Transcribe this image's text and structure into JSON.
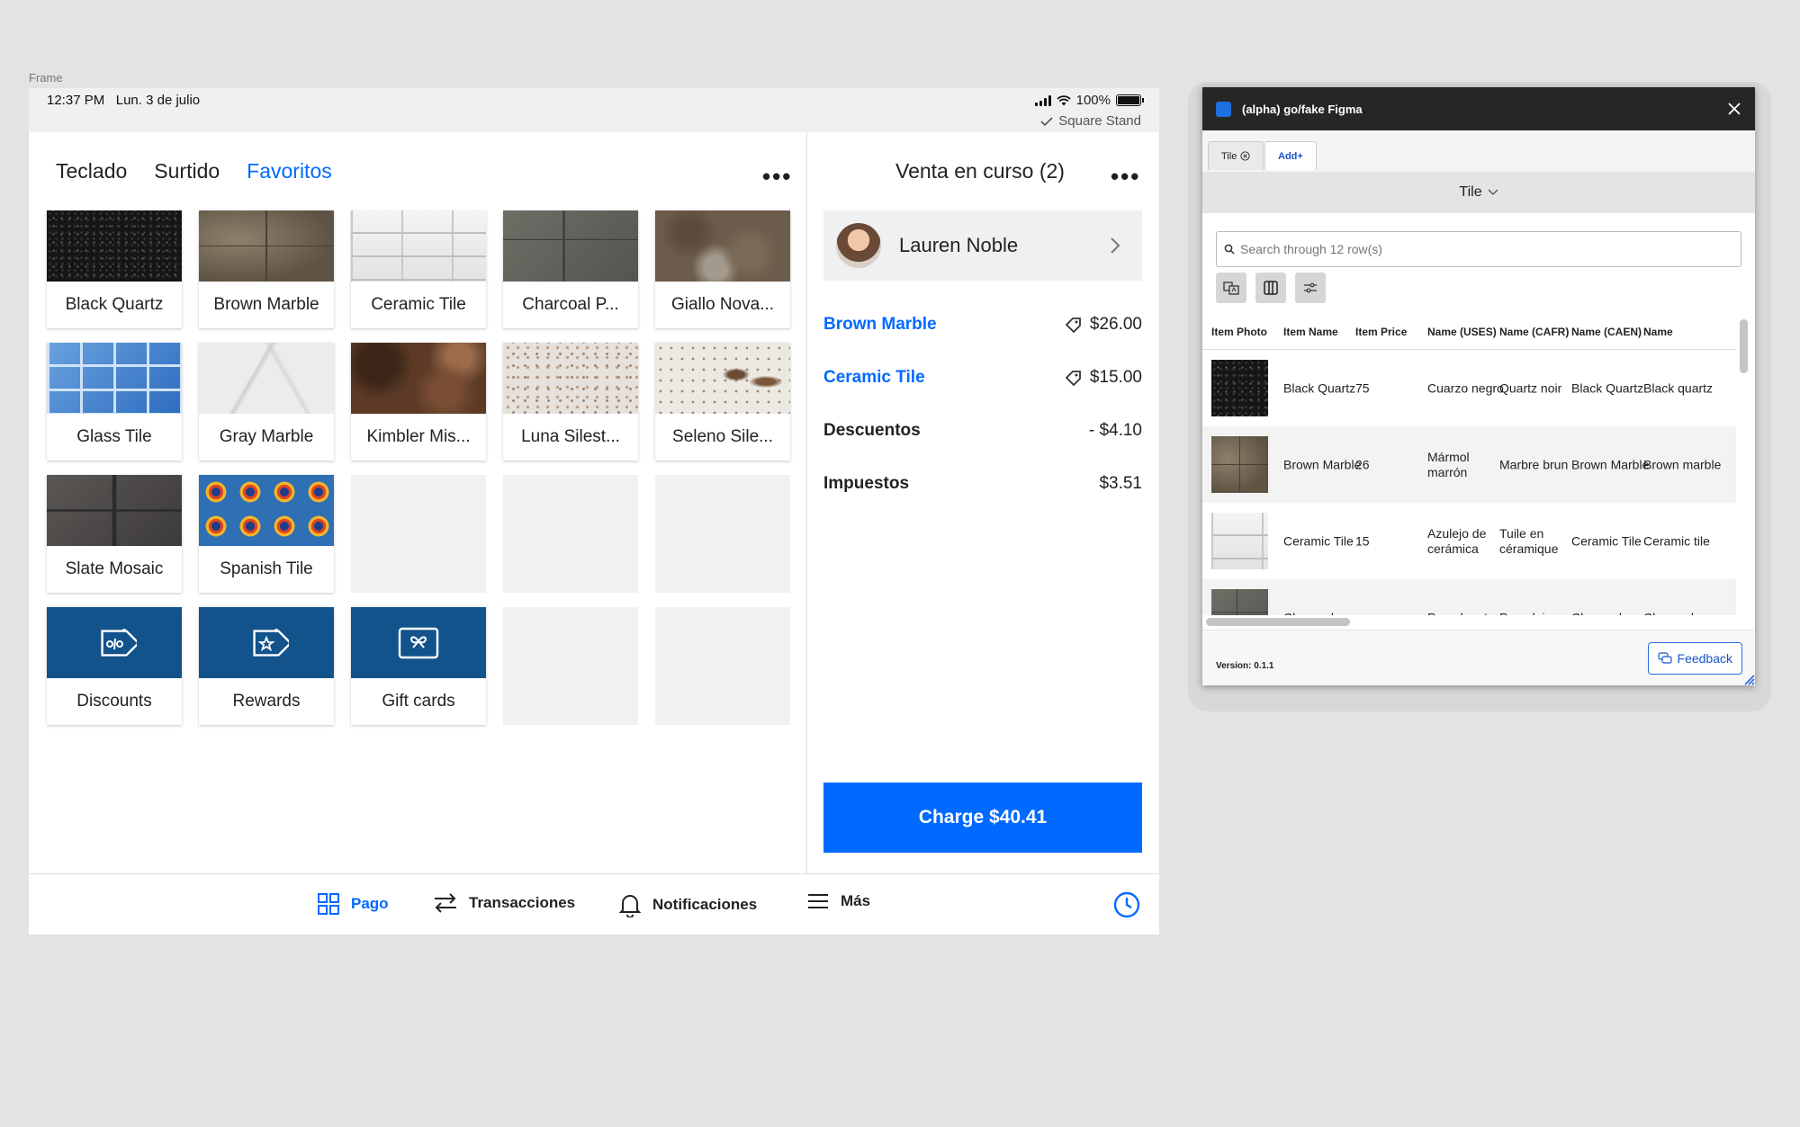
{
  "frame_label": "Frame",
  "status_bar": {
    "time": "12:37 PM",
    "date": "Lun. 3 de julio",
    "battery": "100%",
    "stand": "Square Stand"
  },
  "left_tabs": [
    {
      "label": "Teclado"
    },
    {
      "label": "Surtido"
    },
    {
      "label": "Favoritos"
    }
  ],
  "tiles": [
    {
      "label": "Black Quartz",
      "pattern": "black-quartz"
    },
    {
      "label": "Brown Marble",
      "pattern": "brown-marble"
    },
    {
      "label": "Ceramic Tile",
      "pattern": "ceramic"
    },
    {
      "label": "Charcoal P...",
      "pattern": "charcoal"
    },
    {
      "label": "Giallo Nova...",
      "pattern": "giallo"
    },
    {
      "label": "Glass Tile",
      "pattern": "glass"
    },
    {
      "label": "Gray Marble",
      "pattern": "gray-marble"
    },
    {
      "label": "Kimbler Mis...",
      "pattern": "kimbler"
    },
    {
      "label": "Luna Silest...",
      "pattern": "luna"
    },
    {
      "label": "Seleno Sile...",
      "pattern": "seleno"
    },
    {
      "label": "Slate Mosaic",
      "pattern": "slate"
    },
    {
      "label": "Spanish Tile",
      "pattern": "spanish"
    }
  ],
  "actions": [
    {
      "label": "Discounts",
      "icon": "discount-tag-icon"
    },
    {
      "label": "Rewards",
      "icon": "rewards-tag-icon"
    },
    {
      "label": "Gift cards",
      "icon": "gift-card-icon"
    }
  ],
  "sale": {
    "title": "Venta en curso (2)",
    "customer": "Lauren Noble",
    "items": [
      {
        "name": "Brown Marble",
        "amount": "$26.00"
      },
      {
        "name": "Ceramic Tile",
        "amount": "$15.00"
      }
    ],
    "discounts_label": "Descuentos",
    "discounts_amount": "- $4.10",
    "taxes_label": "Impuestos",
    "taxes_amount": "$3.51",
    "charge_label": "Charge $40.41"
  },
  "bottom_nav": [
    {
      "label": "Pago",
      "icon": "grid-icon"
    },
    {
      "label": "Transacciones",
      "icon": "swap-arrows-icon"
    },
    {
      "label": "Notificaciones",
      "icon": "bell-icon"
    },
    {
      "label": "Más",
      "icon": "menu-icon"
    }
  ],
  "plugin": {
    "title": "(alpha) go/fake Figma",
    "tabs": [
      "Tile",
      "Add+"
    ],
    "sheet": "Tile",
    "search_placeholder": "Search through 12 row(s)",
    "columns": [
      "Item Photo",
      "Item Name",
      "Item Price",
      "Name (USES)",
      "Name (CAFR)",
      "Name (CAEN)",
      "Name"
    ],
    "rows": [
      {
        "pattern": "black-quartz",
        "cells": [
          "Black Quartz",
          "75",
          "Cuarzo negro",
          "Quartz noir",
          "Black Quartz",
          "Black quartz"
        ]
      },
      {
        "pattern": "brown-marble",
        "cells": [
          "Brown Marble",
          "26",
          "Mármol marrón",
          "Marbre brun",
          "Brown Marble",
          "Brown marble"
        ]
      },
      {
        "pattern": "ceramic",
        "cells": [
          "Ceramic Tile",
          "15",
          "Azulejo de cerámica",
          "Tuile en céramique",
          "Ceramic Tile",
          "Ceramic tile"
        ]
      },
      {
        "pattern": "charcoal",
        "cells": [
          "Charcoal",
          "",
          "Porcelanato",
          "Porcelaine",
          "Charcoal",
          "Charcoal"
        ]
      }
    ],
    "version": "Version: 0.1.1",
    "feedback": "Feedback"
  }
}
